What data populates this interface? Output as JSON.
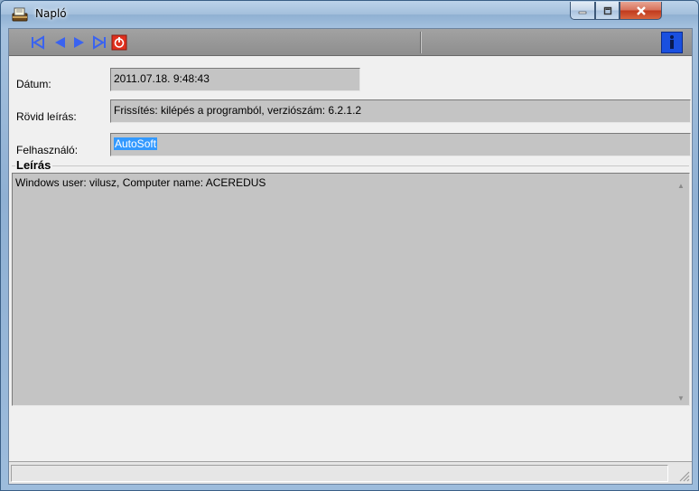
{
  "window": {
    "title": "Napló",
    "icon": "log-book-icon",
    "controls": {
      "minimize": "minimize-icon",
      "maximize": "maximize-icon",
      "close": "close-icon"
    }
  },
  "toolbar": {
    "buttons": [
      {
        "name": "first-record-icon"
      },
      {
        "name": "previous-record-icon"
      },
      {
        "name": "next-record-icon"
      },
      {
        "name": "last-record-icon"
      },
      {
        "name": "exit-icon"
      }
    ],
    "help_icon": "help-icon"
  },
  "form": {
    "date_label": "Dátum:",
    "date_value": "2011.07.18. 9:48:43",
    "short_desc_label": "Rövid leírás:",
    "short_desc_value": "Frissítés: kilépés a programból, verziószám: 6.2.1.2",
    "user_label": "Felhasználó:",
    "user_value": "AutoSoft"
  },
  "description": {
    "title": "Leírás",
    "text": "Windows user: vilusz, Computer name: ACEREDUS"
  },
  "colors": {
    "accent": "#3a63f0",
    "exit_red": "#e0301e",
    "selection": "#3399ff",
    "field_bg": "#c4c4c4"
  }
}
